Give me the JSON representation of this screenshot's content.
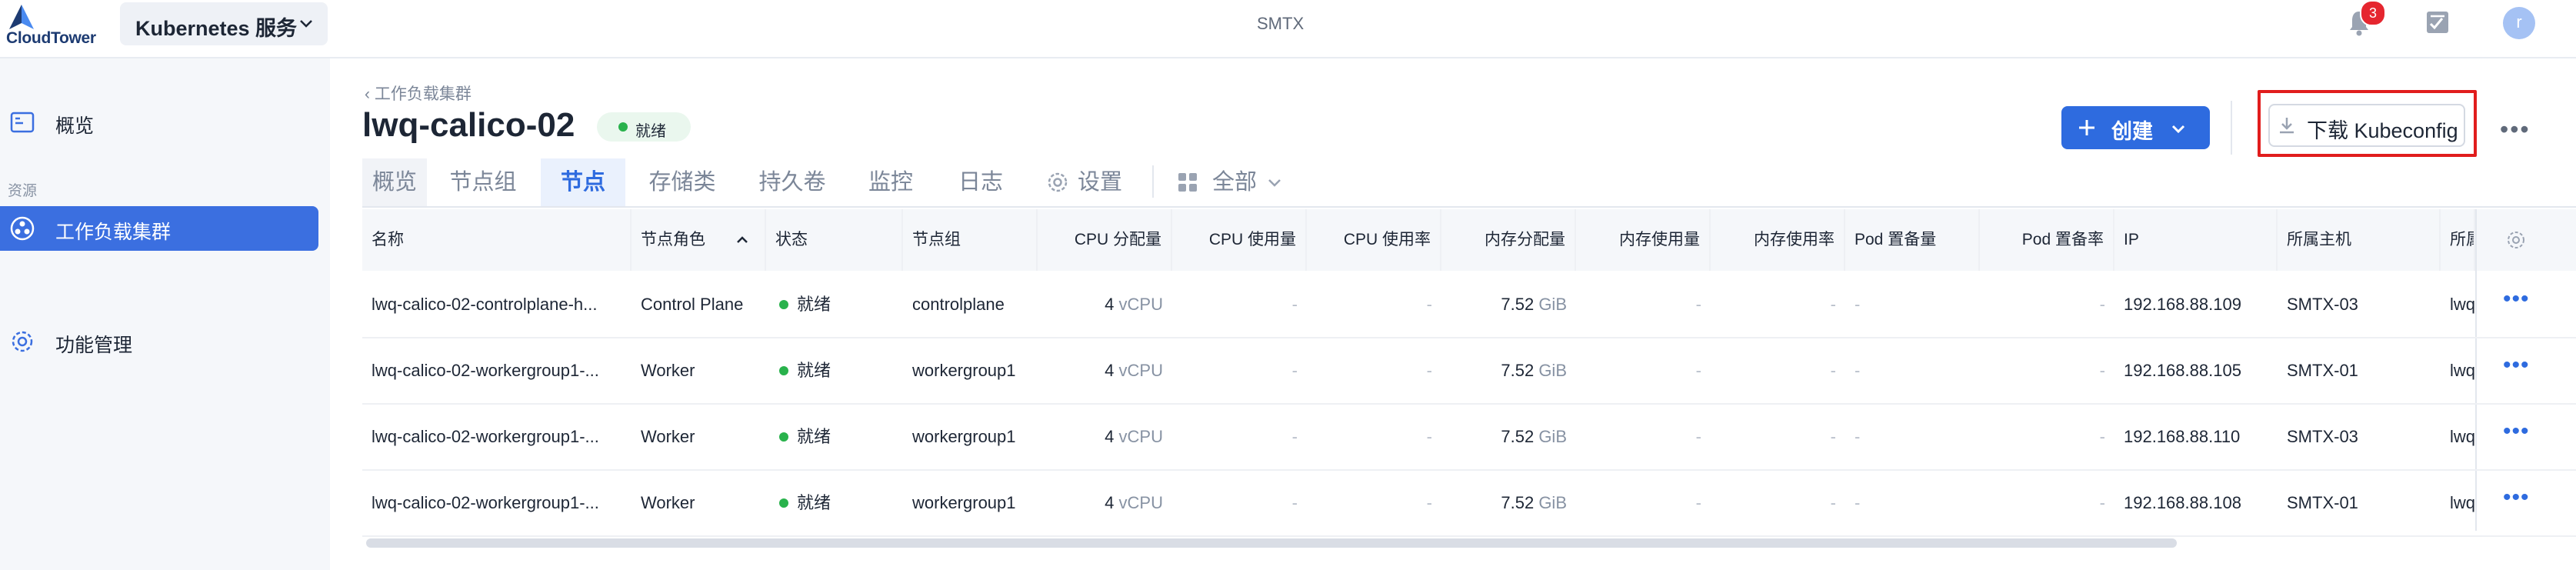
{
  "topbar": {
    "logo_text": "CloudTower",
    "service_select": "Kubernetes 服务",
    "brand": "SMTX",
    "notifications_count": "3",
    "avatar_initial": "r"
  },
  "sidebar": {
    "items": [
      {
        "label": "概览",
        "icon": "dashboard-icon"
      },
      {
        "label": "工作负载集群",
        "icon": "cluster-icon"
      },
      {
        "label": "功能管理",
        "icon": "gear-icon"
      }
    ],
    "section_label": "资源"
  },
  "header": {
    "back_label": "工作负载集群",
    "title": "lwq-calico-02",
    "status": "就绪",
    "create_label": "创建",
    "kubeconfig_label": "下载 Kubeconfig"
  },
  "tabs": [
    {
      "label": "概览"
    },
    {
      "label": "节点组"
    },
    {
      "label": "节点",
      "active": true
    },
    {
      "label": "存储类"
    },
    {
      "label": "持久卷"
    },
    {
      "label": "监控"
    },
    {
      "label": "日志"
    },
    {
      "label": "设置"
    },
    {
      "label": "全部"
    }
  ],
  "table": {
    "columns": [
      "名称",
      "节点角色",
      "状态",
      "节点组",
      "CPU 分配量",
      "CPU 使用量",
      "CPU 使用率",
      "内存分配量",
      "内存使用量",
      "内存使用率",
      "Pod 置备量",
      "Pod 置备率",
      "IP",
      "所属主机",
      "所属"
    ],
    "rows": [
      {
        "name": "lwq-calico-02-controlplane-h...",
        "role": "Control Plane",
        "status": "就绪",
        "group": "controlplane",
        "cpu_alloc": "4",
        "cpu_unit": "vCPU",
        "cpu_used": "-",
        "cpu_rate": "-",
        "mem_alloc": "7.52",
        "mem_unit": "GiB",
        "mem_used": "-",
        "mem_rate": "-",
        "pod_alloc": "-",
        "pod_rate": "-",
        "ip": "192.168.88.109",
        "host": "SMTX-03",
        "extra": "lwq"
      },
      {
        "name": "lwq-calico-02-workergroup1-...",
        "role": "Worker",
        "status": "就绪",
        "group": "workergroup1",
        "cpu_alloc": "4",
        "cpu_unit": "vCPU",
        "cpu_used": "-",
        "cpu_rate": "-",
        "mem_alloc": "7.52",
        "mem_unit": "GiB",
        "mem_used": "-",
        "mem_rate": "-",
        "pod_alloc": "-",
        "pod_rate": "-",
        "ip": "192.168.88.105",
        "host": "SMTX-01",
        "extra": "lwq"
      },
      {
        "name": "lwq-calico-02-workergroup1-...",
        "role": "Worker",
        "status": "就绪",
        "group": "workergroup1",
        "cpu_alloc": "4",
        "cpu_unit": "vCPU",
        "cpu_used": "-",
        "cpu_rate": "-",
        "mem_alloc": "7.52",
        "mem_unit": "GiB",
        "mem_used": "-",
        "mem_rate": "-",
        "pod_alloc": "-",
        "pod_rate": "-",
        "ip": "192.168.88.110",
        "host": "SMTX-03",
        "extra": "lwq"
      },
      {
        "name": "lwq-calico-02-workergroup1-...",
        "role": "Worker",
        "status": "就绪",
        "group": "workergroup1",
        "cpu_alloc": "4",
        "cpu_unit": "vCPU",
        "cpu_used": "-",
        "cpu_rate": "-",
        "mem_alloc": "7.52",
        "mem_unit": "GiB",
        "mem_used": "-",
        "mem_rate": "-",
        "pod_alloc": "-",
        "pod_rate": "-",
        "ip": "192.168.88.108",
        "host": "SMTX-01",
        "extra": "lwq"
      }
    ]
  },
  "colors": {
    "accent": "#2e6bdf",
    "sidebar_active": "#3b6fe0",
    "status_green": "#29b24c",
    "highlight_red": "#e11d1d"
  }
}
